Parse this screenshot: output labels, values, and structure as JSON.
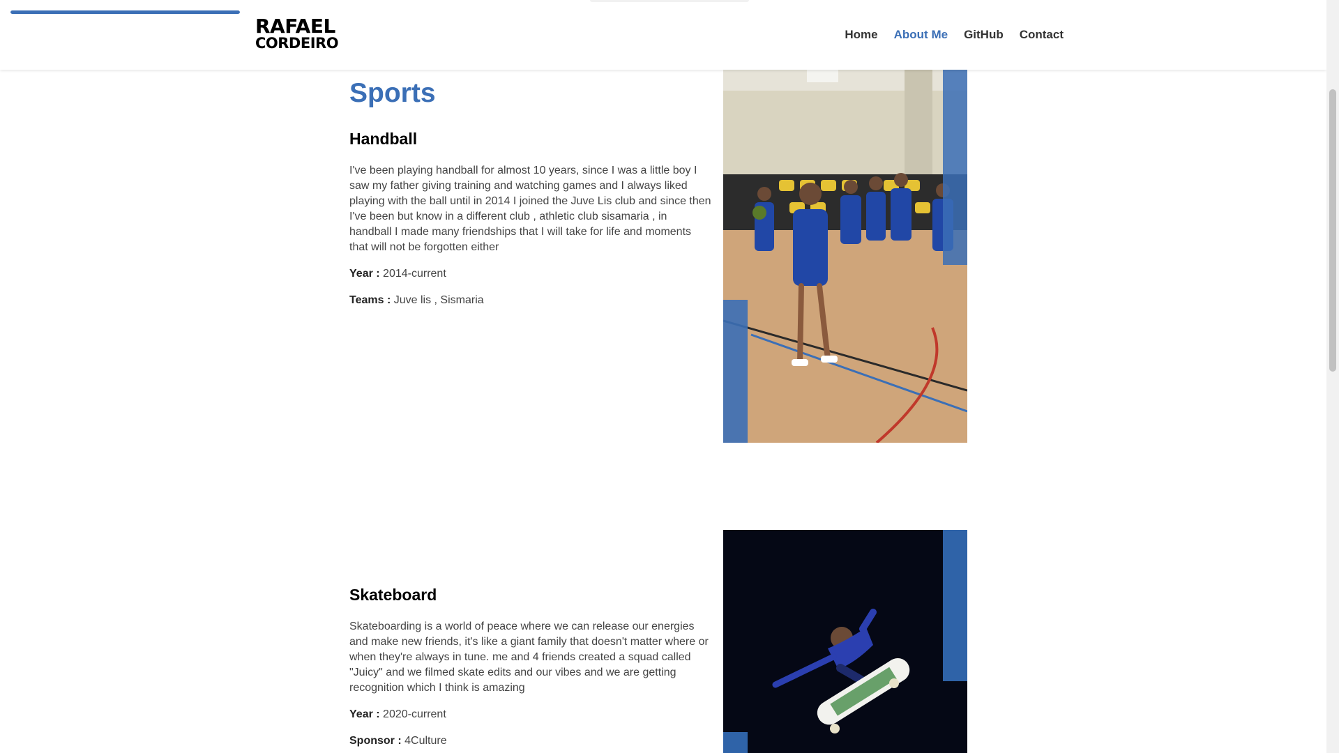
{
  "header": {
    "logo_line1": "RAFAEL",
    "logo_line2": "CORDEIRO",
    "scroll_progress": 0.17,
    "nav": [
      {
        "label": "Home",
        "active": false
      },
      {
        "label": "About Me",
        "active": true
      },
      {
        "label": "GitHub",
        "active": false
      },
      {
        "label": "Contact",
        "active": false
      }
    ]
  },
  "colors": {
    "accent": "#3b6fb6",
    "text": "#444444"
  },
  "section": {
    "title": "Sports"
  },
  "sports": [
    {
      "name": "Handball",
      "description": "I've been playing handball for almost 10 years, since I was a little boy I saw my father giving training and watching games and I always liked playing with the ball until in 2014 I joined the Juve Lis club and since then I've been but know in a different club , athletic club sisamaria , in handball I made many friendships that I will take for life and moments that will not be forgotten either",
      "meta": [
        {
          "label": "Year :",
          "value": "2014-current"
        },
        {
          "label": "Teams :",
          "value": "Juve lis , Sismaria"
        }
      ],
      "photo_icon": "handball-photo"
    },
    {
      "name": "Skateboard",
      "description": "Skateboarding is a world of peace where we can release our energies and make new friends, it's like a giant family that doesn't matter where or when they're always in tune. me and 4 friends created a squad called \"Juicy\" and we filmed skate edits and our vibes and we are getting recognition which I think is amazing",
      "meta": [
        {
          "label": "Year :",
          "value": "2020-current"
        },
        {
          "label": "Sponsor :",
          "value": "4Culture"
        }
      ],
      "photo_icon": "skateboard-photo"
    }
  ]
}
